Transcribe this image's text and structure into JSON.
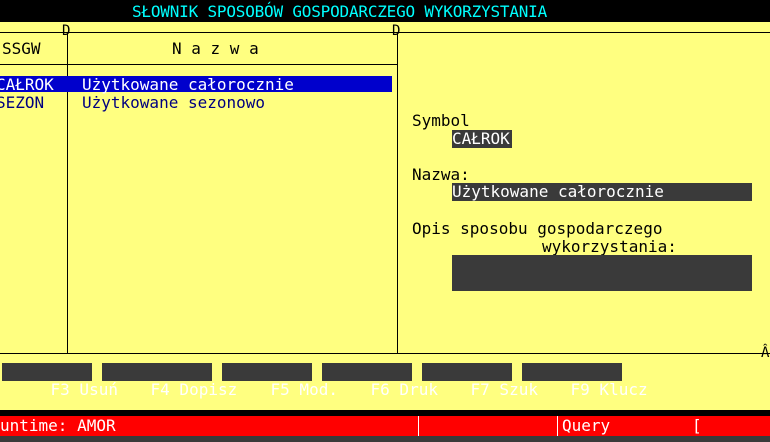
{
  "header": {
    "title": "SŁOWNIK SPOSOBÓW GOSPODARCZEGO WYKORZYSTANIA"
  },
  "table": {
    "columns": [
      "SSGW",
      "N a z w a"
    ],
    "border_markers": [
      "D",
      "D",
      "Â"
    ],
    "rows": [
      {
        "code": "CAŁROK",
        "name": "Użytkowane całorocznie"
      },
      {
        "code": "SEZON",
        "name": "Użytkowane sezonowo"
      }
    ]
  },
  "detail": {
    "symbol_label": "Symbol",
    "symbol_value": "CAŁROK",
    "name_label": "Nazwa:",
    "name_value": "Użytkowane całorocznie",
    "desc_label_line1": "Opis sposobu gospodarczego",
    "desc_label_line2": "wykorzystania:",
    "desc_value": ""
  },
  "function_keys": [
    {
      "label": "F3 Usuń"
    },
    {
      "label": "F4 Dopisz"
    },
    {
      "label": "F5 Mod."
    },
    {
      "label": "F6 Druk"
    },
    {
      "label": "F7 Szuk"
    },
    {
      "label": "F9 Klucz"
    }
  ],
  "status_bar": {
    "runtime": "untime: AMOR",
    "mode": "Query",
    "bracket": "[       ]"
  },
  "colors": {
    "background": "#ffff80",
    "header_text": "#00ffff",
    "selection": "#0000cc",
    "status_bar": "#ff0000",
    "dark_field": "#3a3a3a"
  }
}
